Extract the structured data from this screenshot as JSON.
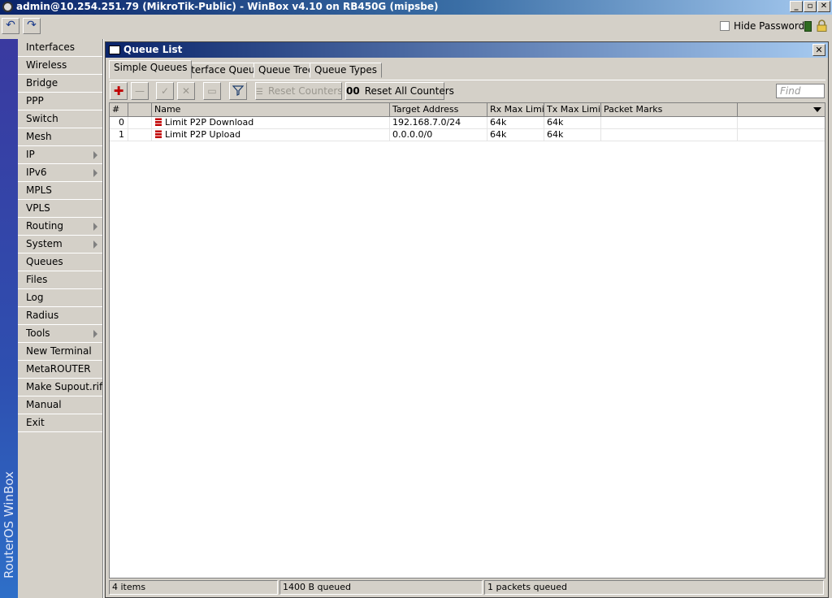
{
  "window": {
    "title": "admin@10.254.251.79 (MikroTik-Public) - WinBox v4.10 on RB450G (mipsbe)",
    "minimize": "_",
    "maximize": "▫",
    "close": "✕"
  },
  "toolbar": {
    "undo_glyph": "↶",
    "redo_glyph": "↷",
    "hide_passwords_label": "Hide Passwords",
    "hide_passwords_checked": false
  },
  "sidebar": {
    "brand": "RouterOS WinBox",
    "items": [
      {
        "label": "Interfaces",
        "submenu": false
      },
      {
        "label": "Wireless",
        "submenu": false
      },
      {
        "label": "Bridge",
        "submenu": false
      },
      {
        "label": "PPP",
        "submenu": false
      },
      {
        "label": "Switch",
        "submenu": false
      },
      {
        "label": "Mesh",
        "submenu": false
      },
      {
        "label": "IP",
        "submenu": true
      },
      {
        "label": "IPv6",
        "submenu": true
      },
      {
        "label": "MPLS",
        "submenu": false
      },
      {
        "label": "VPLS",
        "submenu": false
      },
      {
        "label": "Routing",
        "submenu": true
      },
      {
        "label": "System",
        "submenu": true
      },
      {
        "label": "Queues",
        "submenu": false
      },
      {
        "label": "Files",
        "submenu": false
      },
      {
        "label": "Log",
        "submenu": false
      },
      {
        "label": "Radius",
        "submenu": false
      },
      {
        "label": "Tools",
        "submenu": true
      },
      {
        "label": "New Terminal",
        "submenu": false
      },
      {
        "label": "MetaROUTER",
        "submenu": false
      },
      {
        "label": "Make Supout.rif",
        "submenu": false
      },
      {
        "label": "Manual",
        "submenu": false
      },
      {
        "label": "Exit",
        "submenu": false
      }
    ]
  },
  "queue_window": {
    "title": "Queue List",
    "close": "✕",
    "tabs": [
      "Simple Queues",
      "Interface Queues",
      "Queue Tree",
      "Queue Types"
    ],
    "active_tab": "Simple Queues",
    "buttons": {
      "add_glyph": "✚",
      "remove_glyph": "—",
      "enable_glyph": "✓",
      "disable_glyph": "✕",
      "comment_glyph": "▭",
      "filter_glyph": "▼",
      "reset_counters": "Reset Counters",
      "reset_all_counters": "Reset All Counters",
      "reset_all_prefix": "00"
    },
    "find_placeholder": "Find",
    "columns": [
      "#",
      "",
      "Name",
      "Target Address",
      "Rx Max Limit",
      "Tx Max Limit",
      "Packet Marks",
      ""
    ],
    "rows": [
      {
        "num": "0",
        "name": "Limit P2P Download",
        "target": "192.168.7.0/24",
        "rx": "64k",
        "tx": "64k",
        "marks": ""
      },
      {
        "num": "1",
        "name": "Limit P2P Upload",
        "target": "0.0.0.0/0",
        "rx": "64k",
        "tx": "64k",
        "marks": ""
      }
    ],
    "status": {
      "items": "4 items",
      "queued_bytes": "1400 B queued",
      "queued_packets": "1 packets queued"
    }
  },
  "colors": {
    "titlebar_start": "#0a246a",
    "titlebar_end": "#a6caf0",
    "add_icon": "#c00000",
    "status_green": "#2f6b20",
    "queue_icon": "#c00000"
  }
}
